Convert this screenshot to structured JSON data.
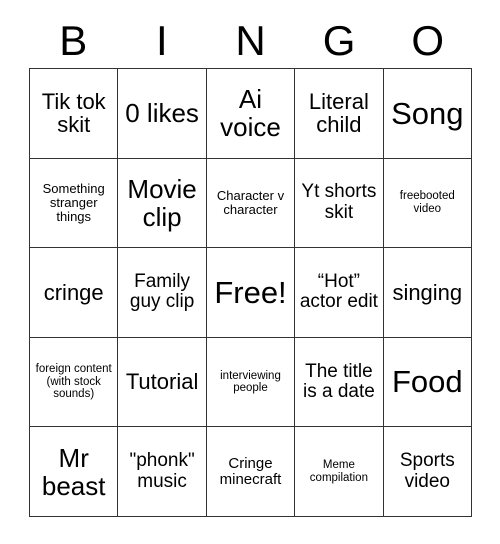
{
  "card": {
    "title": "BINGO",
    "header_letters": [
      "B",
      "I",
      "N",
      "G",
      "O"
    ],
    "colors": {
      "background": "#ffffff",
      "text": "#000000",
      "grid_line": "#333333"
    },
    "free_space_label": "Free!",
    "grid_size": "5x5",
    "rows": [
      [
        {
          "text": "Tik tok skit",
          "size": "l"
        },
        {
          "text": "0 likes",
          "size": "xl"
        },
        {
          "text": "Ai voice",
          "size": "xl"
        },
        {
          "text": "Literal child",
          "size": "l"
        },
        {
          "text": "Song",
          "size": "xxl"
        }
      ],
      [
        {
          "text": "Something stranger things",
          "size": "xs"
        },
        {
          "text": "Movie clip",
          "size": "xl"
        },
        {
          "text": "Character v character",
          "size": "xs"
        },
        {
          "text": "Yt shorts skit",
          "size": "m"
        },
        {
          "text": "freebooted video",
          "size": "xxs"
        }
      ],
      [
        {
          "text": "cringe",
          "size": "l"
        },
        {
          "text": "Family guy clip",
          "size": "m"
        },
        {
          "text": "Free!",
          "size": "xxl"
        },
        {
          "text": "“Hot” actor edit",
          "size": "m"
        },
        {
          "text": "singing",
          "size": "l"
        }
      ],
      [
        {
          "text": "foreign content (with stock sounds)",
          "size": "xxs"
        },
        {
          "text": "Tutorial",
          "size": "l"
        },
        {
          "text": "interviewing people",
          "size": "xxs"
        },
        {
          "text": "The title is a date",
          "size": "m"
        },
        {
          "text": "Food",
          "size": "xxl"
        }
      ],
      [
        {
          "text": "Mr beast",
          "size": "xl"
        },
        {
          "text": "\"phonk\" music",
          "size": "m"
        },
        {
          "text": "Cringe minecraft",
          "size": "s"
        },
        {
          "text": "Meme compilation",
          "size": "xxs"
        },
        {
          "text": "Sports video",
          "size": "m"
        }
      ]
    ]
  }
}
